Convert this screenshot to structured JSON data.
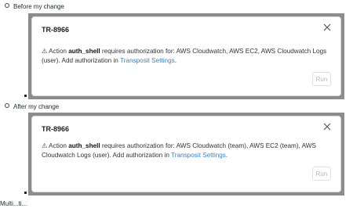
{
  "items": [
    {
      "label": "Before my change",
      "dialog": {
        "title": "TR-8966",
        "warning_symbol": "⚠",
        "msg_prefix": " Action ",
        "action_name": "auth_shell",
        "msg_body": " requires authorization for: AWS Cloudwatch, AWS EC2, AWS Cloudwatch Logs (user). Add authorization in ",
        "link_text": "Transposit Settings",
        "msg_suffix": ".",
        "run_label": "Run"
      }
    },
    {
      "label": "After my change",
      "dialog": {
        "title": "TR-8966",
        "warning_symbol": "⚠",
        "msg_prefix": " Action ",
        "action_name": "auth_shell",
        "msg_body": " requires authorization for: AWS Cloudwatch (team), AWS EC2 (team), AWS Cloudwatch Logs (user). Add authorization in ",
        "link_text": "Transposit Settings",
        "msg_suffix": ".",
        "run_label": "Run"
      }
    }
  ],
  "cutoff_text": "Multi...ti..."
}
